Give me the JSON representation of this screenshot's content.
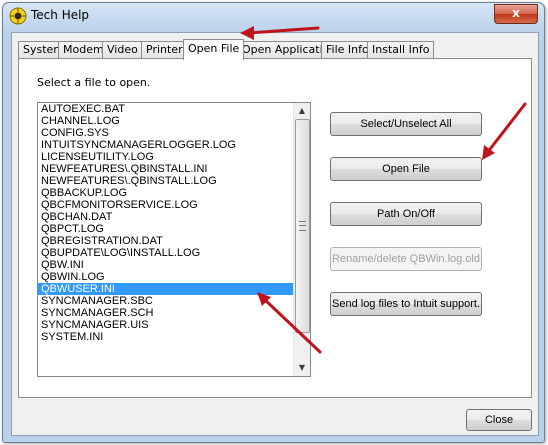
{
  "window": {
    "title": "Tech Help",
    "close_glyph": "x",
    "app_icon": "help-life-ring-icon"
  },
  "tabs": [
    {
      "label": "System",
      "active": false
    },
    {
      "label": "Modem",
      "active": false
    },
    {
      "label": "Video",
      "active": false
    },
    {
      "label": "Printer",
      "active": false
    },
    {
      "label": "Open File",
      "active": true
    },
    {
      "label": "Open Application",
      "active": false
    },
    {
      "label": "File Info",
      "active": false
    },
    {
      "label": "Install Info",
      "active": false
    }
  ],
  "open_file": {
    "instruction": "Select a file to open.",
    "files": [
      "AUTOEXEC.BAT",
      "CHANNEL.LOG",
      "CONFIG.SYS",
      "INTUITSYNCMANAGERLOGGER.LOG",
      "LICENSEUTILITY.LOG",
      "NEWFEATURES\\.QBINSTALL.INI",
      "NEWFEATURES\\.QBINSTALL.LOG",
      "QBBACKUP.LOG",
      "QBCFMONITORSERVICE.LOG",
      "QBCHAN.DAT",
      "QBPCT.LOG",
      "QBREGISTRATION.DAT",
      "QBUPDATE\\LOG\\INSTALL.LOG",
      "QBW.INI",
      "QBWIN.LOG",
      "QBWUSER.INI",
      "SYNCMANAGER.SBC",
      "SYNCMANAGER.SCH",
      "SYNCMANAGER.UIS",
      "SYSTEM.INI"
    ],
    "selected_file": "QBWUSER.INI",
    "buttons": {
      "select_unselect": "Select/Unselect All",
      "open_file": "Open File",
      "path_onoff": "Path On/Off",
      "rename_delete": "Rename/delete QBWin.log.old",
      "send_logs": "Send log files to Intuit support."
    }
  },
  "footer": {
    "close_label": "Close"
  },
  "annotation_color": "#c0141c"
}
